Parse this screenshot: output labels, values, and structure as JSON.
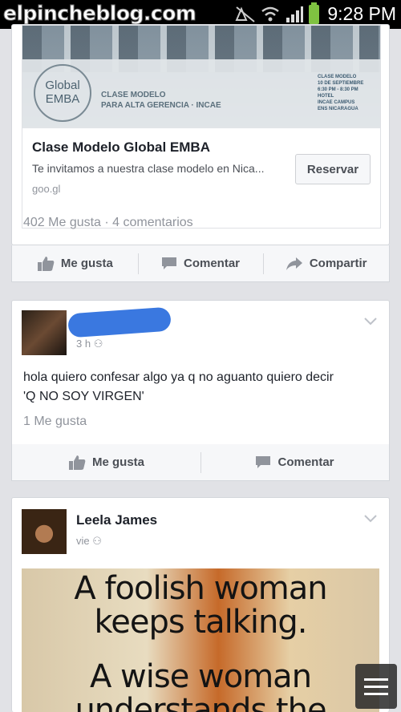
{
  "status_bar": {
    "watermark": "elpincheblog.com",
    "time": "9:28 PM",
    "icons": [
      "mute-icon",
      "wifi-icon",
      "signal-icon",
      "battery-icon"
    ],
    "battery_color": "#7fc241"
  },
  "post1": {
    "preview": {
      "image_logo_line1": "Global",
      "image_logo_line2": "EMBA",
      "image_text_line1": "CLASE MODELO",
      "image_text_line2": "PARA ALTA GERENCIA · INCAE",
      "image_event_info": [
        "CLASE MODELO",
        "10 DE SEPTIEMBRE",
        "6:30 PM - 8:30 PM",
        "HOTEL",
        "INCAE CAMPUS",
        "ENS NICARAGUA"
      ],
      "title": "Clase Modelo Global EMBA",
      "description": "Te invitamos a nuestra clase modelo en Nica...",
      "domain": "goo.gl",
      "button": "Reservar"
    },
    "counts": "402 Me gusta · 4 comentarios",
    "actions": {
      "like": "Me gusta",
      "comment": "Comentar",
      "share": "Compartir"
    }
  },
  "post2": {
    "time": "3 h",
    "text_line1": "hola quiero confesar algo ya q no aguanto quiero decir",
    "text_line2": "'Q NO SOY VIRGEN'",
    "likes": "1 Me gusta",
    "actions": {
      "like": "Me gusta",
      "comment": "Comentar"
    }
  },
  "post3": {
    "author": "Leela James",
    "time": "vie",
    "image_lines": [
      "A foolish woman",
      "keeps talking.",
      "A wise woman",
      "understands the"
    ]
  },
  "colors": {
    "action_text": "#4b4f56",
    "muted": "#90949c",
    "redaction": "#3a78e0"
  }
}
